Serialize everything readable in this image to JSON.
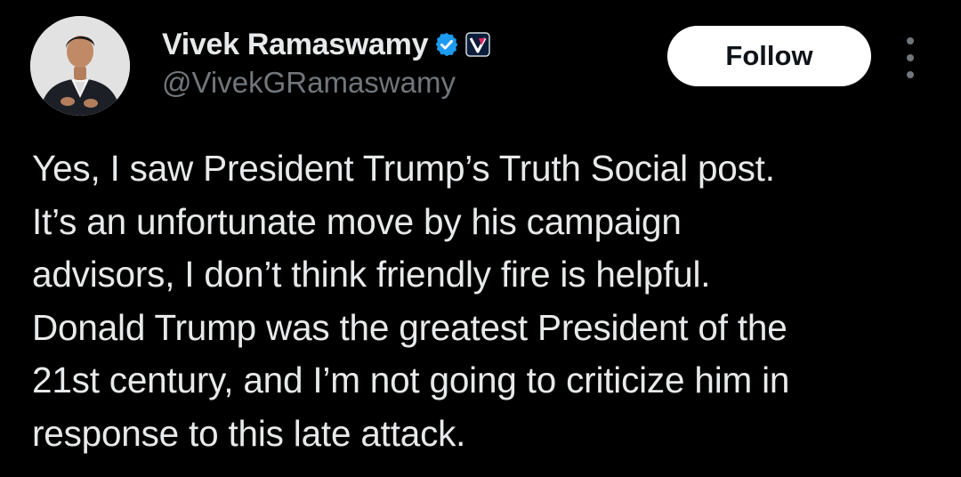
{
  "author": {
    "display_name": "Vivek Ramaswamy",
    "handle": "@VivekGRamaswamy",
    "verified_icon": "verified-badge-icon",
    "affiliate_icon": "vivek-campaign-logo-icon",
    "avatar_icon": "profile-photo"
  },
  "actions": {
    "follow_label": "Follow",
    "more_icon": "more-options-icon"
  },
  "tweet": {
    "lines": [
      "Yes, I saw President Trump’s Truth Social post.",
      "It’s an unfortunate move by his campaign",
      "advisors, I don’t think friendly fire is helpful.",
      "Donald Trump was the greatest President of the",
      "21st century, and I’m not going to criticize him in",
      "response to this late attack."
    ]
  },
  "colors": {
    "background": "#000000",
    "primary_text": "#e7e9ea",
    "secondary_text": "#71767b",
    "verified_blue": "#1d9bf0",
    "follow_bg": "#ffffff",
    "follow_text": "#0f1419"
  }
}
